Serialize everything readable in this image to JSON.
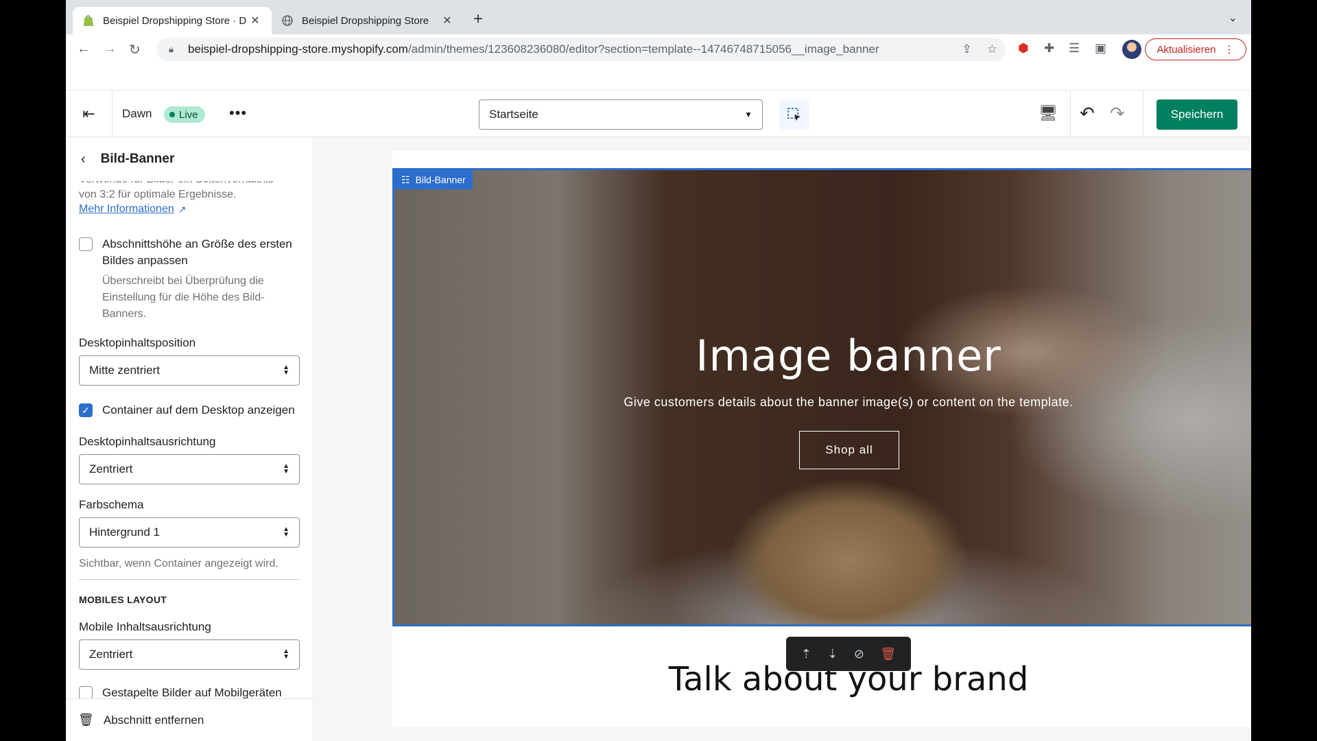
{
  "browser": {
    "tabs": [
      {
        "title": "Beispiel Dropshipping Store · D",
        "active": true
      },
      {
        "title": "Beispiel Dropshipping Store",
        "active": false
      }
    ],
    "url_host": "beispiel-dropshipping-store.myshopify.com",
    "url_path": "/admin/themes/123608236080/editor?section=template--14746748715056__image_banner",
    "update_label": "Aktualisieren"
  },
  "editor": {
    "theme_name": "Dawn",
    "live_label": "Live",
    "page_select": "Startseite",
    "save_label": "Speichern"
  },
  "sidebar": {
    "title": "Bild-Banner",
    "help_partial": "Verwende für Bilder ein Seitenverhältnis",
    "help_text": "von 3:2 für optimale Ergebnisse.",
    "more_info_link": "Mehr Informationen",
    "adapt_height": {
      "label": "Abschnittshöhe an Größe des ersten Bildes anpassen",
      "help": "Überschreibt bei Überprüfung die Einstellung für die Höhe des Bild-Banners.",
      "checked": false
    },
    "desktop_position": {
      "label": "Desktopinhaltsposition",
      "value": "Mitte zentriert"
    },
    "show_container": {
      "label": "Container auf dem Desktop anzeigen",
      "checked": true
    },
    "desktop_alignment": {
      "label": "Desktopinhaltsausrichtung",
      "value": "Zentriert"
    },
    "color_scheme": {
      "label": "Farbschema",
      "value": "Hintergrund 1",
      "help": "Sichtbar, wenn Container angezeigt wird."
    },
    "mobile_heading": "MOBILES LAYOUT",
    "mobile_alignment": {
      "label": "Mobile Inhaltsausrichtung",
      "value": "Zentriert"
    },
    "stacked_images": {
      "label": "Gestapelte Bilder auf Mobilgeräten",
      "checked": false
    },
    "remove_section": "Abschnitt entfernen"
  },
  "preview": {
    "section_tag": "Bild-Banner",
    "banner_title": "Image banner",
    "banner_text": "Give customers details about the banner image(s) or content on the template.",
    "button_label": "Shop all",
    "next_heading": "Talk about your brand"
  }
}
